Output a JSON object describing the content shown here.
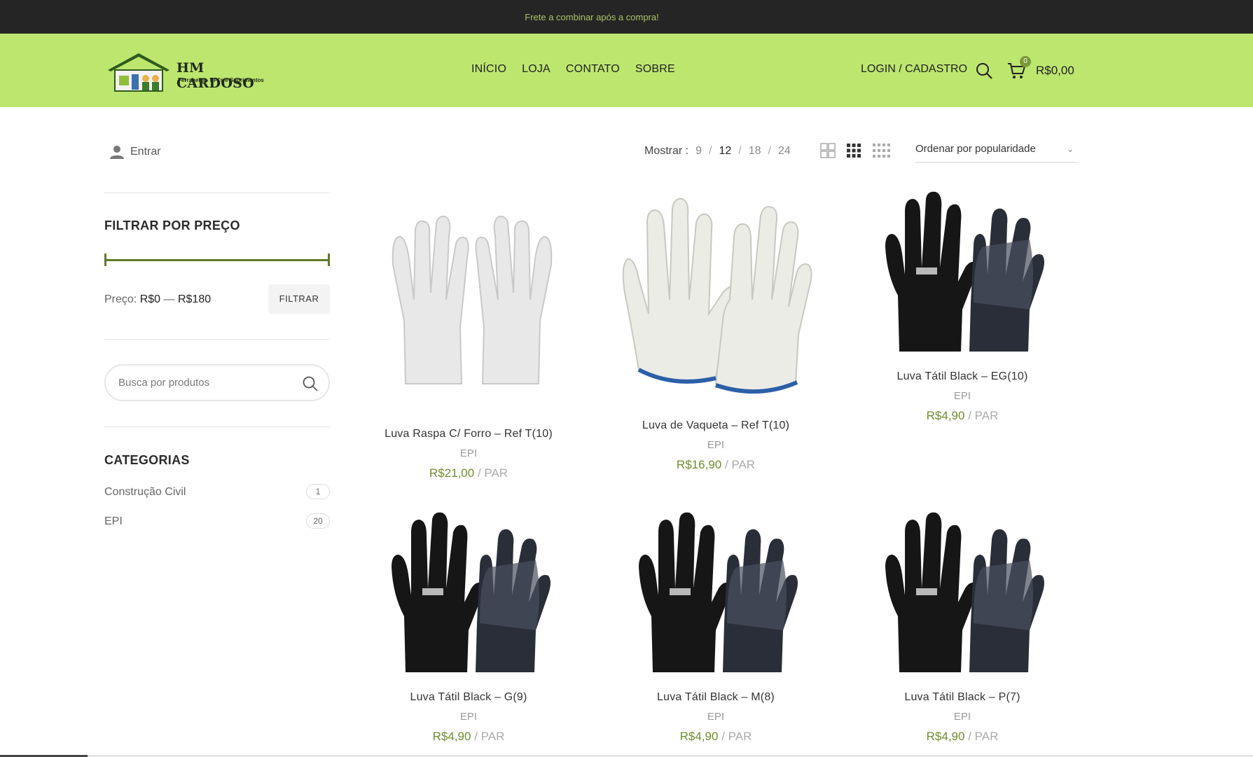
{
  "topbar": {
    "message": "Frete a combinar após a compra!"
  },
  "header": {
    "brand": "HM CARDOSO",
    "tagline": "Ferragens - EPI's e Suprimentos",
    "nav": [
      "INÍCIO",
      "LOJA",
      "CONTATO",
      "SOBRE"
    ],
    "login": "LOGIN / CADASTRO",
    "cart_count": "0",
    "cart_total": "R$0,00",
    "accent": "#bde66f"
  },
  "sidebar": {
    "entrar": "Entrar",
    "price_filter_title": "FILTRAR POR PREÇO",
    "price_label": "Preço:",
    "price_min": "R$0",
    "price_dash": "—",
    "price_max": "R$180",
    "filter_button": "FILTRAR",
    "search_placeholder": "Busca por produtos",
    "categories_title": "CATEGORIAS",
    "categories": [
      {
        "name": "Construção Civil",
        "count": "1"
      },
      {
        "name": "EPI",
        "count": "20"
      }
    ]
  },
  "toolbar": {
    "show_label": "Mostrar :",
    "show_options": [
      "9",
      "12",
      "18",
      "24"
    ],
    "show_selected": "12",
    "sort_label": "Ordenar por popularidade"
  },
  "products": [
    {
      "name": "Luva Raspa C/ Forro – Ref T(10)",
      "category": "EPI",
      "price": "R$21,00",
      "unit": "/ PAR",
      "image": "welding-glove-icon"
    },
    {
      "name": "Luva de Vaqueta – Ref T(10)",
      "category": "EPI",
      "price": "R$16,90",
      "unit": "/ PAR",
      "image": "leather-glove-icon"
    },
    {
      "name": "Luva Tátil Black – EG(10)",
      "category": "EPI",
      "price": "R$4,90",
      "unit": "/ PAR",
      "image": "black-glove-icon"
    },
    {
      "name": "Luva Tátil Black – G(9)",
      "category": "EPI",
      "price": "R$4,90",
      "unit": "/ PAR",
      "image": "black-glove-icon"
    },
    {
      "name": "Luva Tátil Black – M(8)",
      "category": "EPI",
      "price": "R$4,90",
      "unit": "/ PAR",
      "image": "black-glove-icon"
    },
    {
      "name": "Luva Tátil Black – P(7)",
      "category": "EPI",
      "price": "R$4,90",
      "unit": "/ PAR",
      "image": "black-glove-icon"
    }
  ]
}
